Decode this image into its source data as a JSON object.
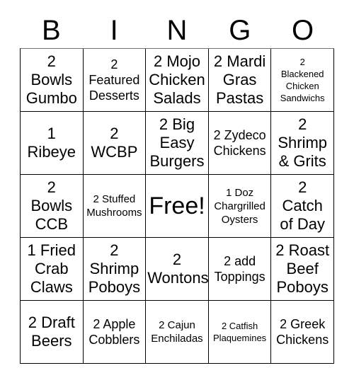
{
  "card": {
    "title_letters": [
      "B",
      "I",
      "N",
      "G",
      "O"
    ],
    "free_space_label": "Free!",
    "columns": 5,
    "rows": 5,
    "text_color": "#000000",
    "background_color": "#ffffff",
    "border_color": "#000000"
  },
  "squares": [
    {
      "text": "2\nBowls\nGumbo",
      "size": "lg"
    },
    {
      "text": "2\nFeatured\nDesserts",
      "size": "md"
    },
    {
      "text": "2 Mojo\nChicken\nSalads",
      "size": "lg"
    },
    {
      "text": "2 Mardi\nGras\nPastas",
      "size": "lg"
    },
    {
      "text": "2\nBlackened\nChicken\nSandwichs",
      "size": "xs"
    },
    {
      "text": "1\nRibeye",
      "size": "lg"
    },
    {
      "text": "2\nWCBP",
      "size": "lg"
    },
    {
      "text": "2 Big\nEasy\nBurgers",
      "size": "lg"
    },
    {
      "text": "2 Zydeco\nChickens",
      "size": "md"
    },
    {
      "text": "2\nShrimp\n& Grits",
      "size": "lg"
    },
    {
      "text": "2\nBowls\nCCB",
      "size": "lg"
    },
    {
      "text": "2 Stuffed\nMushrooms",
      "size": "sm"
    },
    {
      "text": "Free!",
      "size": "xl"
    },
    {
      "text": "1 Doz\nChargrilled\nOysters",
      "size": "sm"
    },
    {
      "text": "2\nCatch\nof Day",
      "size": "lg"
    },
    {
      "text": "1 Fried\nCrab\nClaws",
      "size": "lg"
    },
    {
      "text": "2\nShrimp\nPoboys",
      "size": "lg"
    },
    {
      "text": "2\nWontons",
      "size": "lg"
    },
    {
      "text": "2 add\nToppings",
      "size": "md"
    },
    {
      "text": "2 Roast\nBeef\nPoboys",
      "size": "lg"
    },
    {
      "text": "2 Draft\nBeers",
      "size": "lg"
    },
    {
      "text": "2 Apple\nCobblers",
      "size": "md"
    },
    {
      "text": "2 Cajun\nEnchiladas",
      "size": "sm"
    },
    {
      "text": "2 Catfish\nPlaquemines",
      "size": "xs"
    },
    {
      "text": "2 Greek\nChickens",
      "size": "md"
    }
  ]
}
